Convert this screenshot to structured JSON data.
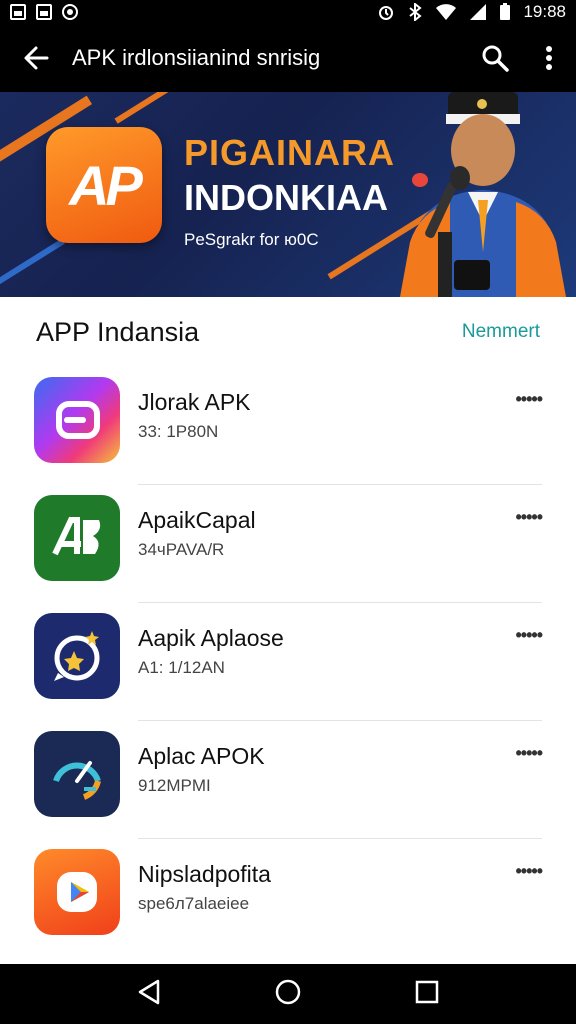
{
  "status": {
    "time": "19:88"
  },
  "app_bar": {
    "title": "APK irdlonsiianind snrisig"
  },
  "banner": {
    "logo_text": "AP",
    "line1": "PIGAINARA",
    "line2": "INDONKIAA",
    "subtitle": "PeSgrakr for ю0C"
  },
  "section": {
    "title": "APP Indansia",
    "link": "Nemmert"
  },
  "apps": [
    {
      "name": "Jlorak APK",
      "meta": "33: 1P80N",
      "icon": "camera-gradient-icon"
    },
    {
      "name": "ApaikCapal",
      "meta": "34чPAVA/R",
      "icon": "green-letters-icon"
    },
    {
      "name": "Aapik Aplaose",
      "meta": "A1: 1/12AN",
      "icon": "star-chat-icon"
    },
    {
      "name": "Aplac APOK",
      "meta": "912MPMI",
      "icon": "speed-gauge-icon"
    },
    {
      "name": "Nipsladpofita",
      "meta": "spe6л7alaeiee",
      "icon": "play-store-icon"
    }
  ],
  "more_label": "•••••",
  "colors": {
    "accent": "#1a9a9a",
    "banner_orange": "#f27a1c",
    "banner_navy": "#1b2a5e"
  }
}
